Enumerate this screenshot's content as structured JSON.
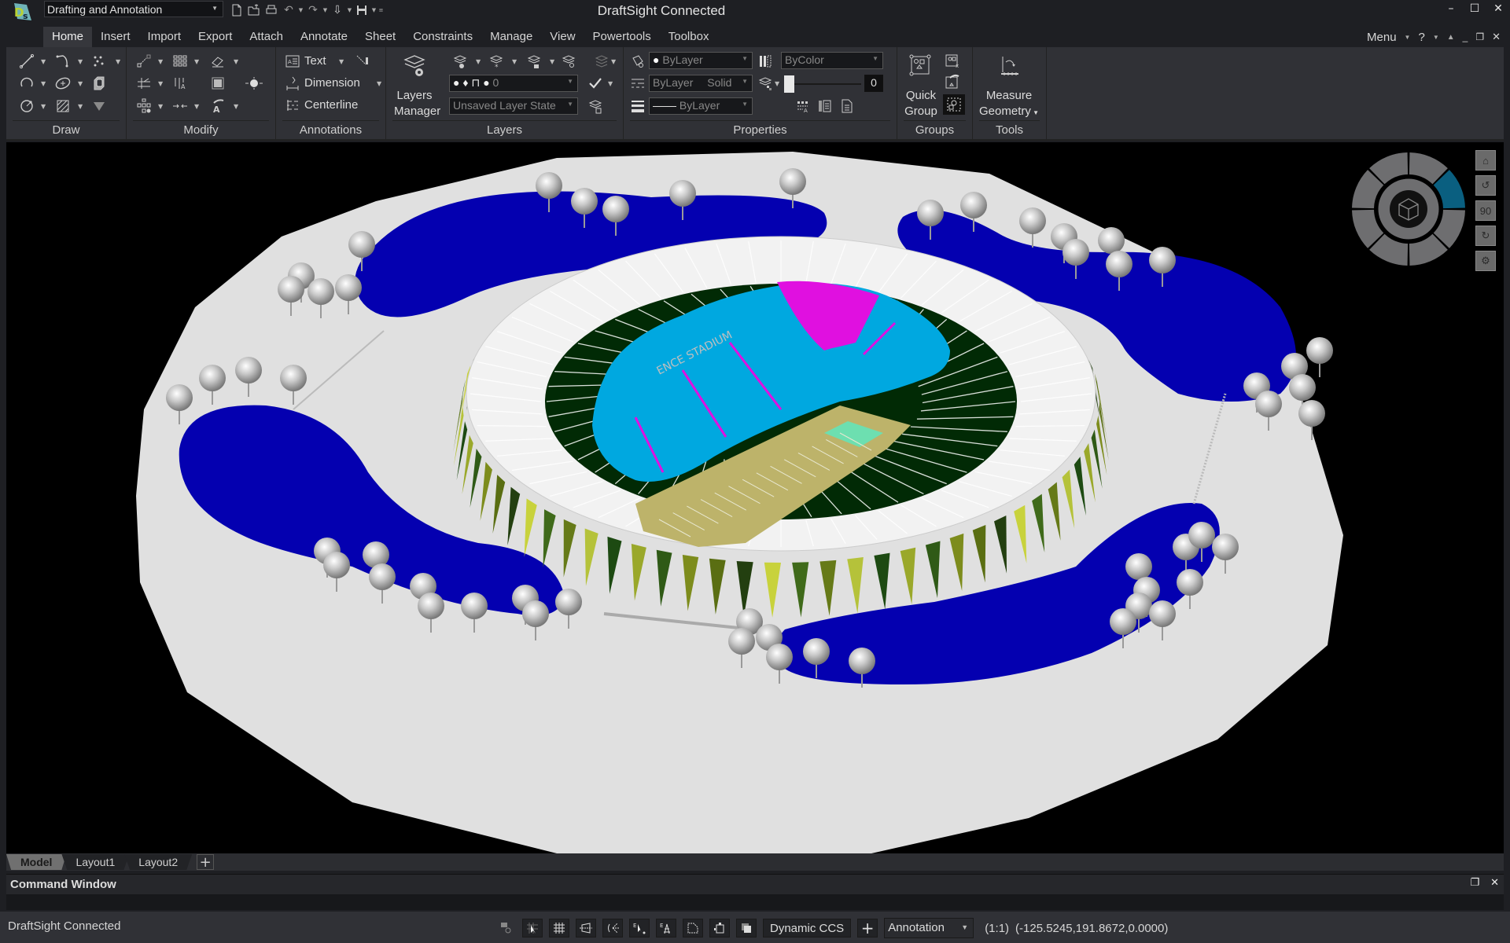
{
  "window": {
    "title": "DraftSight Connected",
    "workspace": "Drafting and Annotation",
    "controls": {
      "minimize": "–",
      "maximize": "☐",
      "close": "✕"
    }
  },
  "quick_access": [
    {
      "name": "new-icon",
      "glyph": "🗋"
    },
    {
      "name": "open-icon",
      "glyph": "📂"
    },
    {
      "name": "print-icon",
      "glyph": "⎙"
    },
    {
      "name": "undo-icon",
      "glyph": "↶"
    },
    {
      "name": "redo-icon",
      "glyph": "↷"
    },
    {
      "name": "select-icon",
      "glyph": "⇩"
    },
    {
      "name": "save-icon",
      "glyph": "💾"
    }
  ],
  "menu": {
    "tabs": [
      "Home",
      "Insert",
      "Import",
      "Export",
      "Attach",
      "Annotate",
      "Sheet",
      "Constraints",
      "Manage",
      "View",
      "Powertools",
      "Toolbox"
    ],
    "active_tab": "Home",
    "right": {
      "menu_label": "Menu",
      "help_label": "?"
    }
  },
  "ribbon": {
    "draw": {
      "label": "Draw"
    },
    "modify": {
      "label": "Modify"
    },
    "annotations": {
      "label": "Annotations",
      "text": "Text",
      "dimension": "Dimension",
      "centerline": "Centerline"
    },
    "layers": {
      "label": "Layers",
      "manager_line1": "Layers",
      "manager_line2": "Manager",
      "current_layer": "0",
      "layer_state": "Unsaved Layer State"
    },
    "properties": {
      "label": "Properties",
      "color": "ByLayer",
      "linestyle_a": "ByLayer",
      "linestyle_b": "Solid",
      "lineweight": "ByLayer",
      "plot_style": "ByColor",
      "transparency": "0",
      "transparency_pct": 0
    },
    "groups": {
      "label": "Groups",
      "quick_group_1": "Quick",
      "quick_group_2": "Group"
    },
    "tools": {
      "label": "Tools",
      "measure_1": "Measure",
      "measure_2": "Geometry"
    }
  },
  "viewport": {
    "model_label": "ENCE STADIUM",
    "nav": {
      "home": "⌂",
      "rotate_left": "↺",
      "ninety": "90",
      "rotate_right": "↻",
      "settings": "⚙"
    },
    "colors": {
      "background": "#000000",
      "ground": "#e0e0e0",
      "water": "#0400b0",
      "seating": "#00a8e0",
      "seating_highlight": "#e010e0",
      "field": "#bdb36a",
      "endzone": "#6ddfb0",
      "inner_ring": "#012a05",
      "roof": "#f0f0f0"
    }
  },
  "layout_tabs": {
    "tabs": [
      "Model",
      "Layout1",
      "Layout2"
    ],
    "active": "Model",
    "add": "+"
  },
  "command_window": {
    "title": "Command Window"
  },
  "status": {
    "text": "DraftSight Connected",
    "ccs": "Dynamic CCS",
    "plus": "+",
    "annotation": "Annotation",
    "scale": "(1:1)",
    "coordinates": "(-125.5245,191.8672,0.0000)"
  }
}
